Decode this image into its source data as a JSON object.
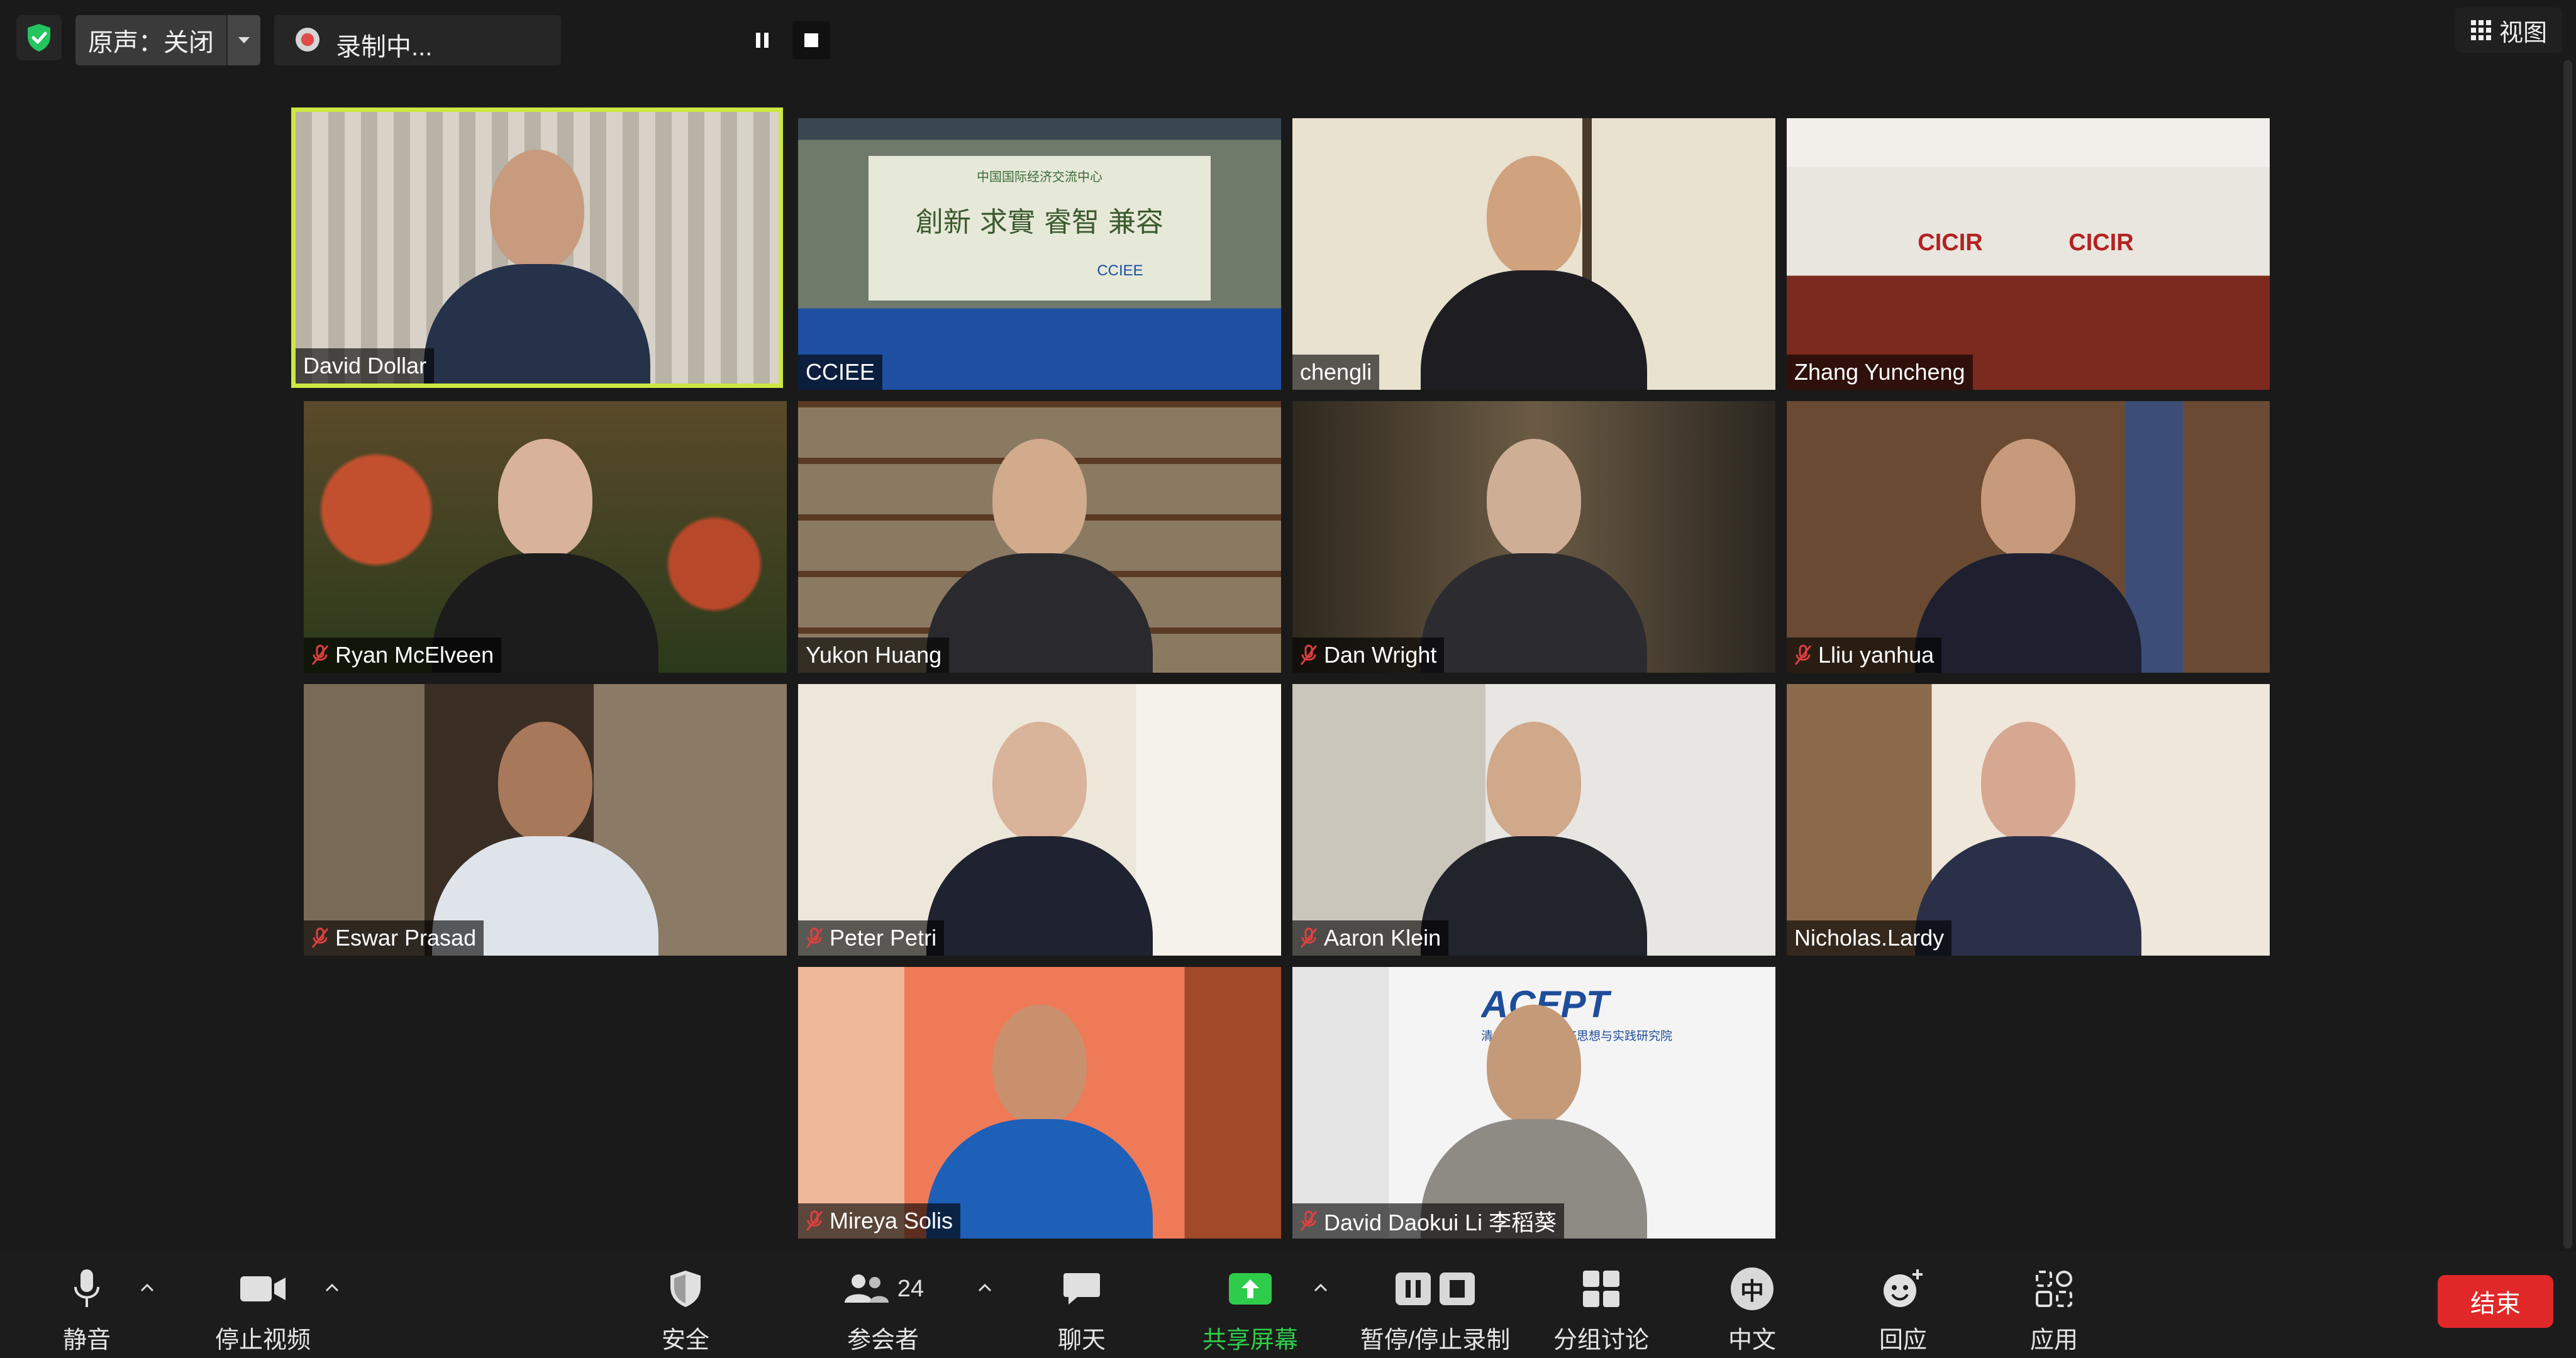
{
  "topbar": {
    "original_sound_label": "原声：关闭",
    "recording_label": "录制中...",
    "view_label": "视图"
  },
  "participants": [
    {
      "name": "David Dollar",
      "muted": false,
      "active_speaker": true
    },
    {
      "name": "CCIEE",
      "muted": false,
      "active_speaker": false
    },
    {
      "name": "chengli",
      "muted": false,
      "active_speaker": false
    },
    {
      "name": "Zhang Yuncheng",
      "muted": false,
      "active_speaker": false
    },
    {
      "name": "Ryan McElveen",
      "muted": true,
      "active_speaker": false
    },
    {
      "name": "Yukon Huang",
      "muted": false,
      "active_speaker": false
    },
    {
      "name": "Dan Wright",
      "muted": true,
      "active_speaker": false
    },
    {
      "name": "Lliu yanhua",
      "muted": true,
      "active_speaker": false
    },
    {
      "name": "Eswar Prasad",
      "muted": true,
      "active_speaker": false
    },
    {
      "name": "Peter Petri",
      "muted": true,
      "active_speaker": false
    },
    {
      "name": "Aaron Klein",
      "muted": true,
      "active_speaker": false
    },
    {
      "name": "Nicholas.Lardy",
      "muted": false,
      "active_speaker": false
    },
    {
      "name": "Mireya Solis",
      "muted": true,
      "active_speaker": false
    },
    {
      "name": "David Daokui Li 李稻葵",
      "muted": true,
      "active_speaker": false
    }
  ],
  "scene_text": {
    "cciee_banner_top": "中国国际经济交流中心",
    "cciee_banner_main": "創新 求實 睿智 兼容",
    "cciee_logo": "CCIEE",
    "cicir_logo": "CICIR",
    "acept_logo": "ACEPT",
    "acept_sub": "清华大学中国经济思想与实践研究院"
  },
  "toolbar": {
    "mute_label": "静音",
    "stop_video_label": "停止视频",
    "security_label": "安全",
    "participants_label": "参会者",
    "participants_count": "24",
    "chat_label": "聊天",
    "share_label": "共享屏幕",
    "record_label": "暂停/停止录制",
    "breakout_label": "分组讨论",
    "interpretation_label": "中文",
    "interpretation_glyph": "中",
    "reactions_label": "回应",
    "apps_label": "应用",
    "end_label": "结束"
  },
  "colors": {
    "active_speaker_border": "#cce842",
    "share_green": "#2ecc4a",
    "end_red": "#e02828",
    "muted_red": "#e04040",
    "shield_green": "#22c55e"
  }
}
